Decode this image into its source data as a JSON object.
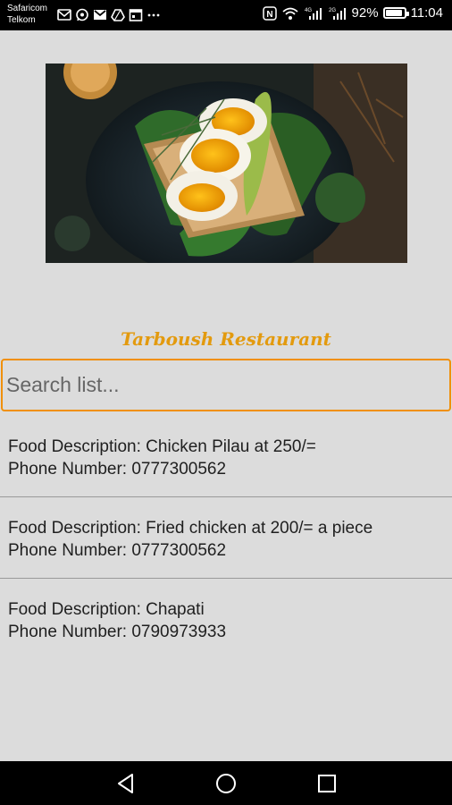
{
  "status_bar": {
    "carrier_line1": "Safaricom",
    "carrier_line2": "Telkom",
    "left_icons": [
      "mail-icon",
      "whatsapp-icon",
      "gmail-icon",
      "drive-icon",
      "calendar-icon",
      "more-icon"
    ],
    "nfc_label": "N",
    "signal_label": "4G",
    "signal2_label": "2G",
    "battery_percent": "92%",
    "battery_level": 0.92,
    "time": "11:04"
  },
  "header": {
    "restaurant_name": "Tarboush Restaurant"
  },
  "search": {
    "placeholder": "Search list...",
    "value": ""
  },
  "food_items": [
    {
      "description": "Food Description: Chicken Pilau at 250/=",
      "phone": "Phone Number: 0777300562"
    },
    {
      "description": "Food Description: Fried chicken at 200/= a piece",
      "phone": "Phone Number: 0777300562"
    },
    {
      "description": "Food Description: Chapati",
      "phone": "Phone Number: 0790973933"
    }
  ],
  "colors": {
    "accent": "#e39a0e",
    "search_border": "#f0900a",
    "background": "#dcdcdc"
  }
}
